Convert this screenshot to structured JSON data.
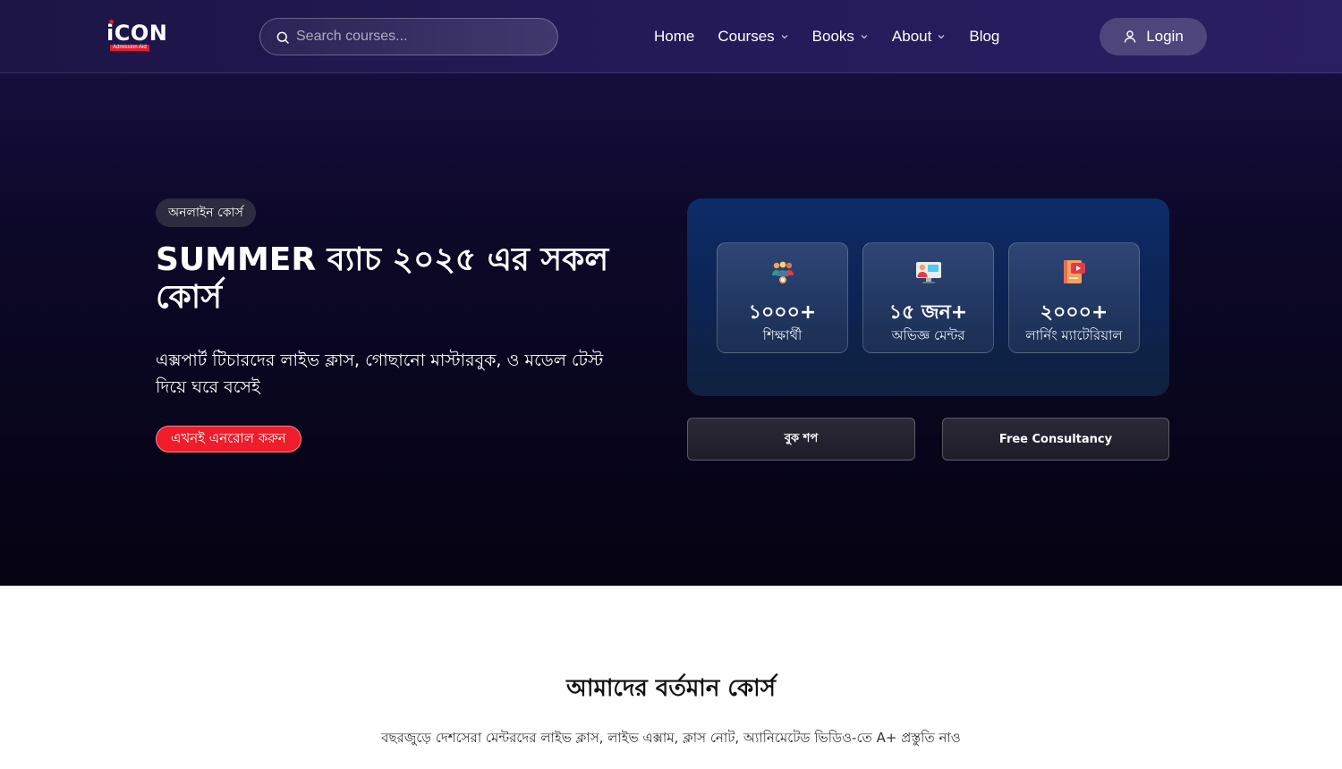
{
  "header": {
    "logo": {
      "text": "iCON",
      "tagline": "Admission Aid"
    },
    "search": {
      "placeholder": "Search courses..."
    },
    "nav": [
      {
        "label": "Home",
        "has_dropdown": false
      },
      {
        "label": "Courses",
        "has_dropdown": true
      },
      {
        "label": "Books",
        "has_dropdown": true
      },
      {
        "label": "About",
        "has_dropdown": true
      },
      {
        "label": "Blog",
        "has_dropdown": false
      }
    ],
    "login_label": "Login"
  },
  "hero": {
    "badge": "অনলাইন কোর্স",
    "title": "SUMMER ব্যাচ ২০২৫ এর সকল কোর্স",
    "description": "এক্সপার্ট টিচারদের লাইভ ক্লাস, গোছানো মাস্টারবুক, ও মডেল টেস্ট দিয়ে ঘরে বসেই",
    "cta_label": "এখনই এনরোল করুন"
  },
  "stats": [
    {
      "icon": "students-group-icon",
      "value": "১০০০+",
      "label": "শিক্ষার্থী"
    },
    {
      "icon": "mentor-presentation-icon",
      "value": "১৫ জন+",
      "label": "অভিজ্ঞ মেন্টর"
    },
    {
      "icon": "video-book-icon",
      "value": "২০০০+",
      "label": "লার্নিং ম্যাটেরিয়াল"
    }
  ],
  "actions": {
    "bookshop_label": "বুক শপ",
    "consultancy_label": "Free Consultancy"
  },
  "courses_section": {
    "title": "আমাদের বর্তমান কোর্স",
    "subtitle": "বছরজুড়ে দেশসেরা মেন্টরদের লাইভ ক্লাস, লাইভ এক্সাম, ক্লাস নোট, অ্যানিমেটেড ভিডিও-তে A+ প্রস্তুতি নাও"
  },
  "colors": {
    "accent_red": "#ef1c2a",
    "hero_bg": "#0c0828",
    "stats_panel": "#0e2c68"
  }
}
